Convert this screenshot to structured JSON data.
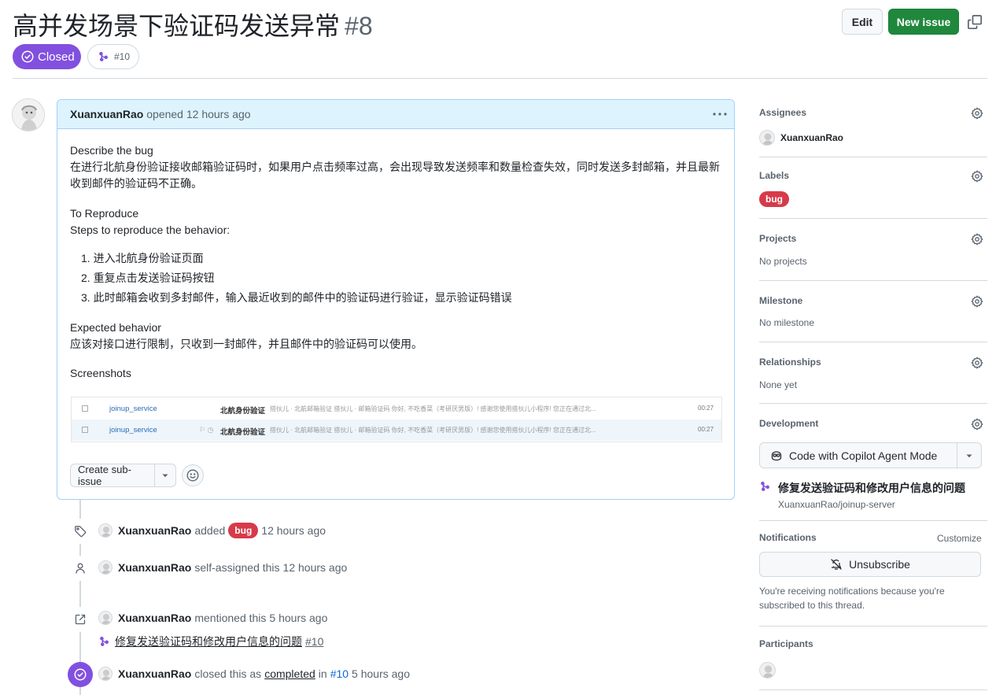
{
  "issue": {
    "title": "高并发场景下验证码发送异常",
    "number": "#8",
    "state": "Closed",
    "linked_pr": "#10"
  },
  "header": {
    "edit_label": "Edit",
    "new_issue_label": "New issue"
  },
  "comment": {
    "author": "XuanxuanRao",
    "meta": "opened 12 hours ago",
    "describe_heading": "Describe the bug",
    "describe_text": "在进行北航身份验证接收邮箱验证码时，如果用户点击频率过高，会出现导致发送频率和数量检查失效，同时发送多封邮箱，并且最新收到邮件的验证码不正确。",
    "reproduce_heading": "To Reproduce",
    "reproduce_intro": "Steps to reproduce the behavior:",
    "steps": [
      "1. 进入北航身份验证页面",
      "2. 重复点击发送验证码按钮",
      "3. 此时邮箱会收到多封邮件，输入最近收到的邮件中的验证码进行验证，显示验证码错误"
    ],
    "expected_heading": "Expected behavior",
    "expected_text": "应该对接口进行限制，只收到一封邮件，并且邮件中的验证码可以使用。",
    "screenshots_heading": "Screenshots",
    "screenshot_rows": [
      {
        "service": "joinup_service",
        "subject": "北航身份验证",
        "snippet": "搭伙儿 · 北航邮箱验证 搭伙儿 · 邮箱验证码 你好, 不吃香菜（考研厌男版）! 感谢您使用搭伙儿小程序! 您正在通过北...",
        "time": "00:27"
      },
      {
        "service": "joinup_service",
        "subject": "北航身份验证",
        "snippet": "搭伙儿 · 北航邮箱验证 搭伙儿 · 邮箱验证码 你好, 不吃香菜（考研厌男版）! 感谢您使用搭伙儿小程序! 您正在通过北...",
        "time": "00:27"
      }
    ],
    "create_subissue_label": "Create sub-issue"
  },
  "timeline": [
    {
      "icon": "tag-icon",
      "user": "XuanxuanRao",
      "action": "added",
      "label": "bug",
      "time": "12 hours ago"
    },
    {
      "icon": "person-icon",
      "user": "XuanxuanRao",
      "action": "self-assigned this",
      "time": "12 hours ago"
    },
    {
      "icon": "cross-reference-icon",
      "user": "XuanxuanRao",
      "action": "mentioned this",
      "time": "5 hours ago",
      "ref_title": "修复发送验证码和修改用户信息的问题",
      "ref_number": "#10"
    },
    {
      "icon": "check-circle-icon",
      "user": "XuanxuanRao",
      "action": "closed this as",
      "link": "completed",
      "in": "in",
      "pr": "#10",
      "time": "5 hours ago"
    }
  ],
  "sidebar": {
    "assignees": {
      "label": "Assignees",
      "user": "XuanxuanRao"
    },
    "labels": {
      "label": "Labels",
      "value": "bug"
    },
    "projects": {
      "label": "Projects",
      "value": "No projects"
    },
    "milestone": {
      "label": "Milestone",
      "value": "No milestone"
    },
    "relationships": {
      "label": "Relationships",
      "value": "None yet"
    },
    "development": {
      "label": "Development",
      "copilot_label": "Code with Copilot Agent Mode",
      "pr_title": "修复发送验证码和修改用户信息的问题",
      "pr_repo": "XuanxuanRao/joinup-server"
    },
    "notifications": {
      "label": "Notifications",
      "customize": "Customize",
      "unsubscribe": "Unsubscribe",
      "reason": "You're receiving notifications because you're subscribed to this thread."
    },
    "participants": {
      "label": "Participants"
    }
  },
  "colors": {
    "closed_purple": "#8250df",
    "primary_green": "#1f883d",
    "bug_red": "#d73a4a",
    "link_blue": "#0969da",
    "comment_header_bg": "#ddf4ff"
  }
}
